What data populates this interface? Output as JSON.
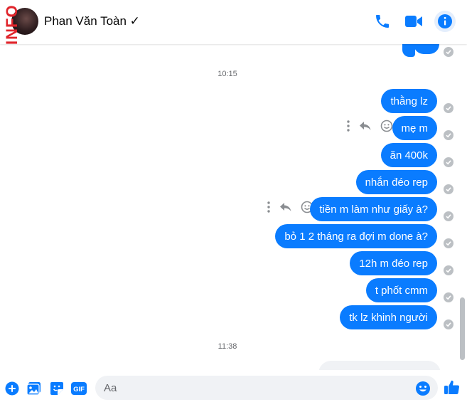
{
  "watermark": "INFO",
  "contact": {
    "name": "Phan Văn Toàn ✓"
  },
  "timestamps": {
    "first": "10:15",
    "second": "11:38"
  },
  "messages": [
    "thằng lz",
    "mẹ m",
    "ăn 400k",
    "nhắn đéo rep",
    "tiền m làm như giấy à?",
    "bỏ 1 2 tháng ra đợi m done à?",
    "12h m đéo rep",
    "t phốt cmm",
    "tk lz khinh người"
  ],
  "composer": {
    "placeholder": "Aa"
  },
  "icons": {
    "call": "phone-icon",
    "video": "video-icon",
    "info": "info-icon",
    "add": "plus-icon",
    "photo": "photo-icon",
    "sticker": "sticker-icon",
    "gif": "gif-icon",
    "emoji": "emoji-icon",
    "like": "thumbs-up-icon",
    "more": "more-vertical-icon",
    "reply": "reply-icon",
    "react": "smiley-icon",
    "seen": "check-circle-icon"
  },
  "colors": {
    "accent": "#0a7cff",
    "bubble_text": "#ffffff",
    "tick": "#bcc0c4",
    "watermark": "#e0242b"
  }
}
